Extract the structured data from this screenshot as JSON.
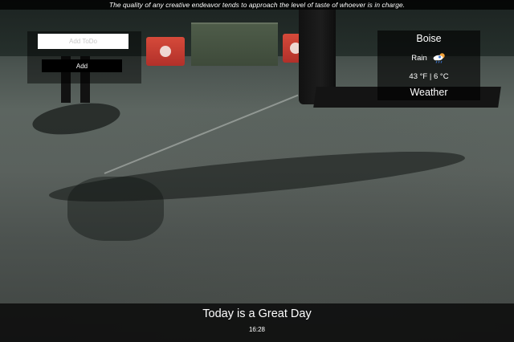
{
  "quote": {
    "text": "The quality of any creative endeavor tends to approach the level of taste of whoever is in charge."
  },
  "todo": {
    "input_placeholder": "Add ToDo",
    "add_label": "Add"
  },
  "weather": {
    "city": "Boise",
    "condition": "Rain",
    "condition_icon": "cloud-sun-rain-icon",
    "temperature": "43 °F | 6 °C",
    "label": "Weather"
  },
  "footer": {
    "message": "Today is a Great Day",
    "time": "16:28"
  },
  "colors": {
    "panel_bg": "#000000",
    "text": "#ffffff",
    "input_bg": "#ffffff"
  }
}
